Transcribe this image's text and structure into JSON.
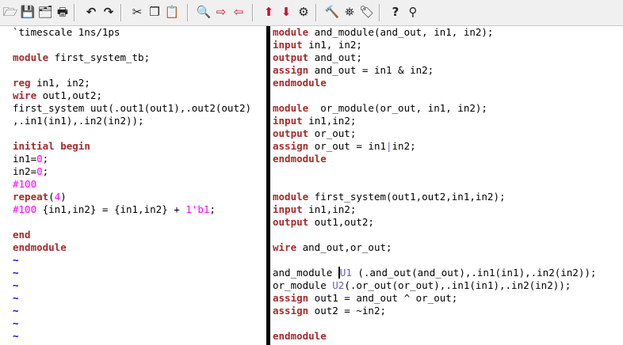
{
  "toolbar": {
    "buttons": [
      {
        "name": "open-folder-icon",
        "glyph": "🗁",
        "style": ""
      },
      {
        "name": "save-icon",
        "glyph": "💾",
        "style": ""
      },
      {
        "name": "save-all-icon",
        "glyph": "🗂",
        "style": ""
      },
      {
        "name": "print-icon",
        "glyph": "🖶",
        "style": ""
      },
      {
        "name": "undo-icon",
        "glyph": "↶",
        "style": "bold"
      },
      {
        "name": "redo-icon",
        "glyph": "↷",
        "style": "bold"
      },
      {
        "name": "cut-icon",
        "glyph": "✂",
        "style": ""
      },
      {
        "name": "copy-icon",
        "glyph": "❐",
        "style": ""
      },
      {
        "name": "paste-icon",
        "glyph": "📋",
        "style": ""
      },
      {
        "name": "find-icon",
        "glyph": "🔍",
        "style": ""
      },
      {
        "name": "find-next-icon",
        "glyph": "⇨",
        "style": "red"
      },
      {
        "name": "find-previous-icon",
        "glyph": "⇦",
        "style": "red"
      },
      {
        "name": "load-session-icon",
        "glyph": "⬆",
        "style": "red"
      },
      {
        "name": "save-session-icon",
        "glyph": "⬇",
        "style": "red"
      },
      {
        "name": "run-script-icon",
        "glyph": "⚙",
        "style": ""
      },
      {
        "name": "make-icon",
        "glyph": "🔨",
        "style": ""
      },
      {
        "name": "ctags-icon",
        "glyph": "⛯",
        "style": ""
      },
      {
        "name": "jump-to-tag-icon",
        "glyph": "🏷",
        "style": ""
      },
      {
        "name": "help-icon",
        "glyph": "?",
        "style": "bold"
      },
      {
        "name": "find-help-icon",
        "glyph": "⚲",
        "style": ""
      }
    ]
  },
  "left_pane": {
    "lines": [
      [
        [
          "`timescale 1ns/1ps",
          "tx"
        ]
      ],
      [],
      [
        [
          "module",
          "kw"
        ],
        [
          " first_system_tb;",
          "tx"
        ]
      ],
      [],
      [
        [
          "reg",
          "kw"
        ],
        [
          " in1, in2;",
          "tx"
        ]
      ],
      [
        [
          "wire",
          "kw"
        ],
        [
          " out1,out2;",
          "tx"
        ]
      ],
      [
        [
          "first_system uut(.out1(out1),.out2(out2)",
          "tx"
        ]
      ],
      [
        [
          ",.in1(in1),.in2(in2));",
          "tx"
        ]
      ],
      [],
      [
        [
          "initial",
          "kw"
        ],
        [
          " ",
          "tx"
        ],
        [
          "begin",
          "kw"
        ]
      ],
      [
        [
          "in1=",
          "tx"
        ],
        [
          "0",
          "num"
        ],
        [
          ";",
          "tx"
        ]
      ],
      [
        [
          "in2=",
          "tx"
        ],
        [
          "0",
          "num"
        ],
        [
          ";",
          "tx"
        ]
      ],
      [
        [
          "#100",
          "num"
        ]
      ],
      [
        [
          "repeat",
          "kw"
        ],
        [
          "(",
          "tx"
        ],
        [
          "4",
          "num"
        ],
        [
          ")",
          "tx"
        ]
      ],
      [
        [
          "#100",
          "num"
        ],
        [
          " {in1,in2} = {in1,in2} + ",
          "tx"
        ],
        [
          "1'b1",
          "num"
        ],
        [
          ";",
          "tx"
        ]
      ],
      [],
      [
        [
          "end",
          "kw"
        ]
      ],
      [
        [
          "endmodule",
          "kw"
        ]
      ],
      [
        [
          "~",
          "tl"
        ]
      ],
      [
        [
          "~",
          "tl"
        ]
      ],
      [
        [
          "~",
          "tl"
        ]
      ],
      [
        [
          "~",
          "tl"
        ]
      ],
      [
        [
          "~",
          "tl"
        ]
      ],
      [
        [
          "~",
          "tl"
        ]
      ],
      [
        [
          "~",
          "tl"
        ]
      ]
    ]
  },
  "right_pane": {
    "lines": [
      [
        [
          "module",
          "kw"
        ],
        [
          " and_module(and_out, in1, in2);",
          "tx"
        ]
      ],
      [
        [
          "input",
          "kw"
        ],
        [
          " in1, in2;",
          "tx"
        ]
      ],
      [
        [
          "output",
          "kw"
        ],
        [
          " and_out;",
          "tx"
        ]
      ],
      [
        [
          "assign",
          "kw"
        ],
        [
          " and_out = in1 & in2;",
          "tx"
        ]
      ],
      [
        [
          "endmodule",
          "kw"
        ]
      ],
      [],
      [
        [
          "module",
          "kw"
        ],
        [
          "  or_module(or_out, in1, in2);",
          "tx"
        ]
      ],
      [
        [
          "input",
          "kw"
        ],
        [
          " in1,in2;",
          "tx"
        ]
      ],
      [
        [
          "output",
          "kw"
        ],
        [
          " or_out;",
          "tx"
        ]
      ],
      [
        [
          "assign",
          "kw"
        ],
        [
          " or_out = in1",
          "tx"
        ],
        [
          "|",
          "del"
        ],
        [
          "in2;",
          "tx"
        ]
      ],
      [
        [
          "endmodule",
          "kw"
        ]
      ],
      [],
      [],
      [
        [
          "module",
          "kw"
        ],
        [
          " first_system(out1,out2,in1,in2);",
          "tx"
        ]
      ],
      [
        [
          "input",
          "kw"
        ],
        [
          " in1,in2;",
          "tx"
        ]
      ],
      [
        [
          "output",
          "kw"
        ],
        [
          " out1,out2;",
          "tx"
        ]
      ],
      [],
      [
        [
          "wire",
          "kw"
        ],
        [
          " and_out,or_out;",
          "tx"
        ]
      ],
      [],
      [
        [
          "and_module ",
          "tx"
        ],
        [
          "U",
          "cur"
        ],
        [
          "1",
          "id"
        ],
        [
          " (.and_out(and_out),.in1(in1),.in2(in2));",
          "tx"
        ]
      ],
      [
        [
          "or_module ",
          "tx"
        ],
        [
          "U2",
          "id"
        ],
        [
          "(.or_out(or_out),.in1(in1),.in2(in2));",
          "tx"
        ]
      ],
      [
        [
          "assign",
          "kw"
        ],
        [
          " out1 = and_out ^ or_out;",
          "tx"
        ]
      ],
      [
        [
          "assign",
          "kw"
        ],
        [
          " out2 = ~in2;",
          "tx"
        ]
      ],
      [],
      [
        [
          "endmodule",
          "kw"
        ]
      ]
    ]
  }
}
